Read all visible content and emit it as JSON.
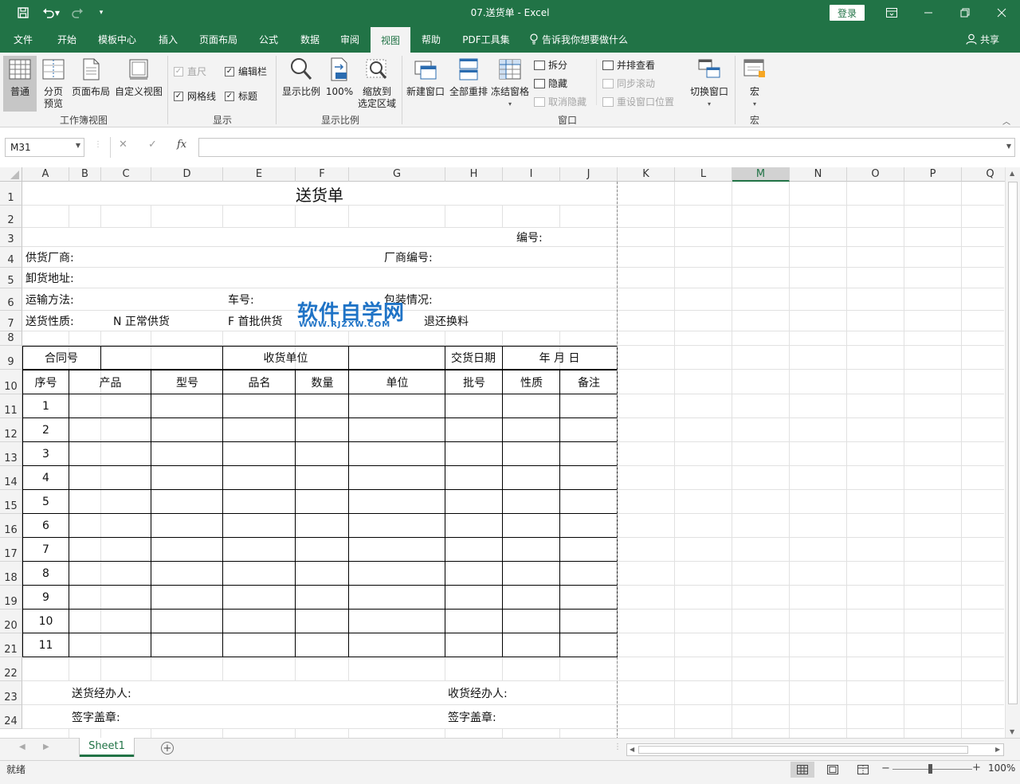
{
  "title_bar": {
    "doc_title": "07.送货单  -  Excel",
    "login_label": "登录"
  },
  "menu": {
    "tabs": [
      "文件",
      "开始",
      "模板中心",
      "插入",
      "页面布局",
      "公式",
      "数据",
      "审阅",
      "视图",
      "帮助",
      "PDF工具集"
    ],
    "active_tab": "视图",
    "tellme": "告诉我你想要做什么",
    "share": "共享"
  },
  "ribbon": {
    "workbook_views": {
      "normal": "普通",
      "page_break_1": "分页",
      "page_break_2": "预览",
      "page_layout": "页面布局",
      "custom_views": "自定义视图",
      "group_label": "工作簿视图"
    },
    "show": {
      "ruler": "直尺",
      "formula_bar": "编辑栏",
      "gridlines": "网格线",
      "headings": "标题",
      "group_label": "显示"
    },
    "zoom": {
      "zoom": "显示比例",
      "hundred": "100%",
      "zoom_sel_1": "缩放到",
      "zoom_sel_2": "选定区域",
      "group_label": "显示比例"
    },
    "window": {
      "new_window": "新建窗口",
      "arrange_all": "全部重排",
      "freeze": "冻结窗格",
      "split": "拆分",
      "hide": "隐藏",
      "unhide": "取消隐藏",
      "side_by_side": "并排查看",
      "sync_scroll": "同步滚动",
      "reset_pos": "重设窗口位置",
      "switch": "切换窗口",
      "group_label": "窗口"
    },
    "macros": {
      "macros": "宏",
      "group_label": "宏"
    }
  },
  "formula_bar": {
    "name_box": "M31",
    "fx": "fx",
    "value": ""
  },
  "sheet": {
    "columns": [
      "A",
      "B",
      "C",
      "D",
      "E",
      "F",
      "G",
      "H",
      "I",
      "J",
      "K",
      "L",
      "M",
      "N",
      "O",
      "P",
      "Q"
    ],
    "selected_column": "M",
    "rows": [
      "1",
      "2",
      "3",
      "4",
      "5",
      "6",
      "7",
      "8",
      "9",
      "10",
      "11",
      "12",
      "13",
      "14",
      "15",
      "16",
      "17",
      "18",
      "19",
      "20",
      "21",
      "22",
      "23",
      "24"
    ],
    "doc_title": "送货单",
    "number_label": "编号:",
    "supplier": "供货厂商:",
    "vendor_no": "厂商编号:",
    "unload_addr": "卸货地址:",
    "transport": "运输方法:",
    "truck_no": "车号:",
    "package": "包装情况:",
    "delivery_type": "送货性质:",
    "normal_supply": "N 正常供货",
    "first_supply": "F  首批供货",
    "return_exchange": "退还换料",
    "contract_no": "合同号",
    "receiver_unit": "收货单位",
    "delivery_date": "交货日期",
    "date_ymd": "年    月    日",
    "table_headers": [
      "序号",
      "产品",
      "型号",
      "品名",
      "数量",
      "单位",
      "批号",
      "性质",
      "备注"
    ],
    "seq_numbers": [
      "1",
      "2",
      "3",
      "4",
      "5",
      "6",
      "7",
      "8",
      "9",
      "10",
      "11"
    ],
    "sender_agent": "送货经办人:",
    "receiver_agent": "收货经办人:",
    "signature_left": "签字盖章:",
    "signature_right": "签字盖章:",
    "watermark_cn": "软件自学网",
    "watermark_en": "WWW.RJZXW.COM"
  },
  "sheet_tabs": {
    "active": "Sheet1"
  },
  "status_bar": {
    "status": "就绪",
    "zoom": "100%"
  }
}
